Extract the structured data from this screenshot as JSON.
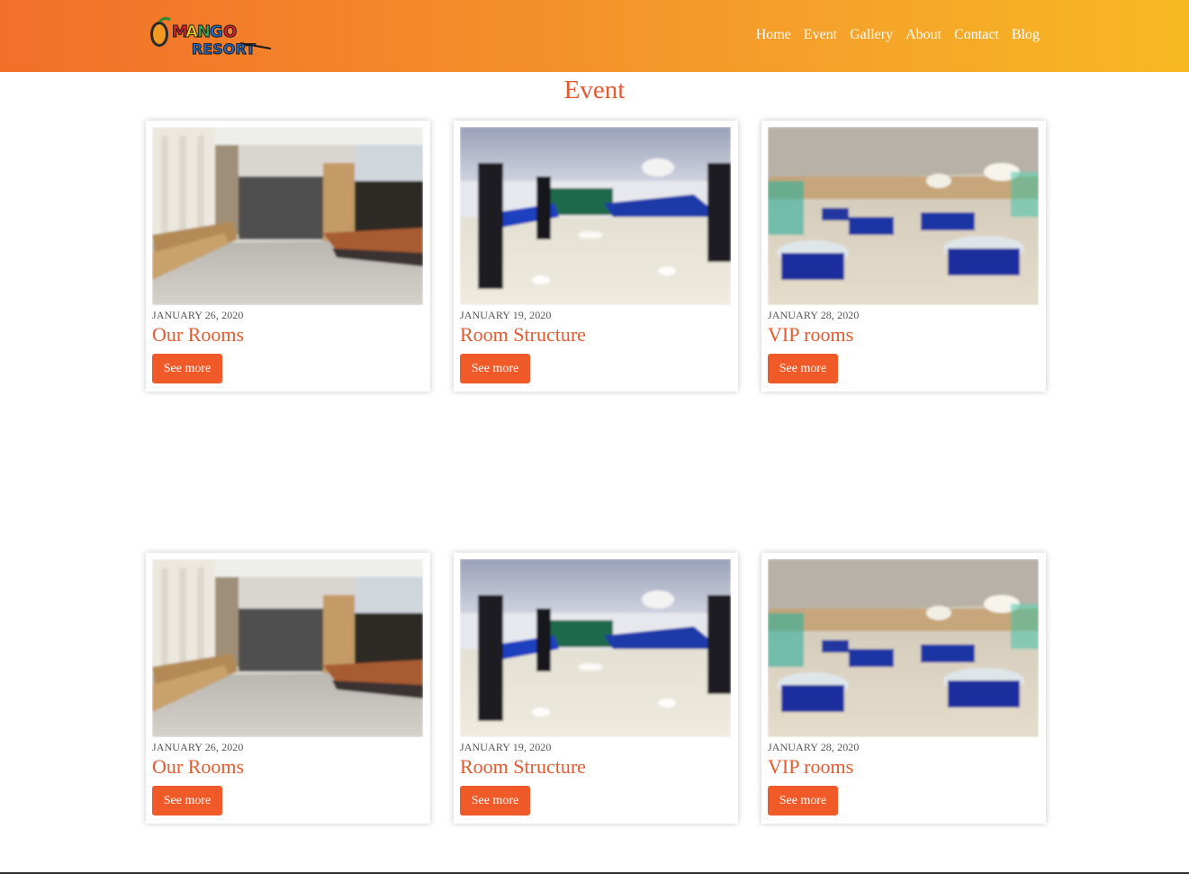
{
  "brand": {
    "logo_icon": "mango-resort-logo",
    "logo_text": "MANGO RESORT",
    "header_gradient": [
      "#f26f2a",
      "#f8b922"
    ]
  },
  "nav": {
    "items": [
      {
        "label": "Home"
      },
      {
        "label": "Event"
      },
      {
        "label": "Gallery"
      },
      {
        "label": "About"
      },
      {
        "label": "Contact"
      },
      {
        "label": "Blog"
      }
    ]
  },
  "page": {
    "title": "Event",
    "accent_color": "#e35a30",
    "button_color": "#f05a28"
  },
  "events": [
    {
      "date": "JANUARY 26, 2020",
      "title": "Our Rooms",
      "button": "See more",
      "image": "lounge-room-photo"
    },
    {
      "date": "JANUARY 19, 2020",
      "title": "Room Structure",
      "button": "See more",
      "image": "hall-structure-photo"
    },
    {
      "date": "JANUARY 28, 2020",
      "title": "VIP rooms",
      "button": "See more",
      "image": "vip-banquet-photo"
    },
    {
      "date": "JANUARY 26, 2020",
      "title": "Our Rooms",
      "button": "See more",
      "image": "lounge-room-photo"
    },
    {
      "date": "JANUARY 19, 2020",
      "title": "Room Structure",
      "button": "See more",
      "image": "hall-structure-photo"
    },
    {
      "date": "JANUARY 28, 2020",
      "title": "VIP rooms",
      "button": "See more",
      "image": "vip-banquet-photo"
    }
  ]
}
